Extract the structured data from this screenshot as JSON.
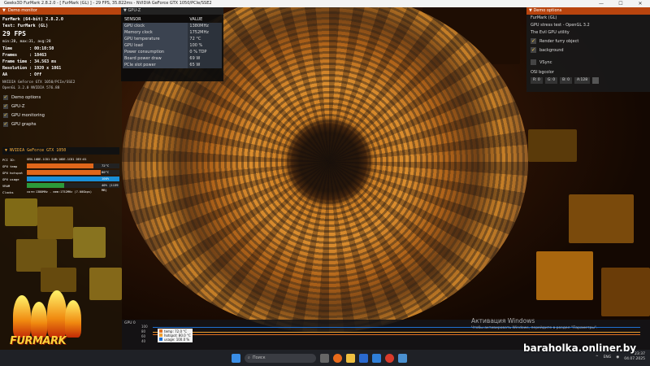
{
  "window": {
    "title": "Geeks3D FurMark 2.8.2.0 - [ FurMark (GL) ] - 29 FPS, 35.822ms - NVIDIA GeForce GTX 1050/PCIe/SSE2",
    "minimize": "—",
    "maximize": "☐",
    "close": "✕"
  },
  "demo_monitor": {
    "header": "Demo monitor",
    "app": "FurMark (64-bit) 2.8.2.0",
    "test": "Test: FurMark (GL)",
    "fps": "29 FPS",
    "minmax": "min:28, max:31, avg:28",
    "time": "Time       : 00:10:50",
    "frames": "Frames     : 18463",
    "frame_time": "Frame time : 34.563 ms",
    "resolution": "Resolution : 1920 x 1061",
    "aa": "AA         : Off",
    "gpu_name": "NVIDIA GeForce GTX 1050/PCIe/SSE2",
    "opengl": "OpenGL 3.2.0 NVIDIA 576.88",
    "checkboxes": [
      "Demo options",
      "GPU-Z",
      "GPU monitoring",
      "GPU graphs"
    ]
  },
  "gpu_monitor": {
    "header": "NVIDIA GeForce GTX 1050",
    "pci": "GEN-10DE-1C81 SUB:10DE-1C81 DEV:01",
    "rows": [
      {
        "label": "GPU temp",
        "value": "72°C",
        "fraction": 0.72,
        "color": "#e0661a"
      },
      {
        "label": "GPU hotspot",
        "value": "80°C",
        "fraction": 0.8,
        "color": "#e0661a"
      },
      {
        "label": "GPU usage",
        "value": "100%",
        "fraction": 1.0,
        "color": "#1a8fd8"
      },
      {
        "label": "VRAM",
        "value": "40% (1139 MB)",
        "fraction": 0.4,
        "color": "#2c9a3a"
      }
    ],
    "clocks_label": "Clocks",
    "clocks_value": "core:1380MHz - mem:1752MHz (7.00Gbps)"
  },
  "gpuz": {
    "header": "GPU-Z",
    "col_sensor": "SENSOR",
    "col_value": "VALUE",
    "rows": [
      [
        "GPU clock",
        "1380MHz"
      ],
      [
        "Memory clock",
        "1752MHz"
      ],
      [
        "GPU temperature",
        "72 °C"
      ],
      [
        "GPU load",
        "100 %"
      ],
      [
        "Power consumption",
        "0 % TDP"
      ],
      [
        "Board power draw",
        "69 W"
      ],
      [
        "PCIe slot power",
        "65 W"
      ]
    ]
  },
  "demo_options": {
    "header": "Demo options",
    "line1": "FurMark (GL)",
    "line2": "GPU stress test - OpenGL 3.2",
    "line3": "The Evil GPU utility",
    "options": [
      {
        "label": "Render furry object",
        "checked": true
      },
      {
        "label": "background",
        "checked": true
      },
      {
        "label": "VSync",
        "checked": false
      }
    ],
    "bg_label": "OSI bgcolor",
    "bg_values": [
      "R: 0",
      "G: 0",
      "B: 0",
      "A:128"
    ]
  },
  "logo": {
    "text": "FURMARK"
  },
  "graph": {
    "label": "GPU 0",
    "ticks": [
      "100",
      "80",
      "60",
      "40"
    ],
    "legend": [
      {
        "text": "temp: 72.0 °C",
        "color": "#e07020"
      },
      {
        "text": "hotspot: 80.0 °C",
        "color": "#f0a030"
      },
      {
        "text": "usage: 100.0 %",
        "color": "#2070d0"
      }
    ]
  },
  "activation": {
    "title": "Активация Windows",
    "subtitle": "Чтобы активировать Windows, перейдите в раздел \"Параметры\"."
  },
  "taskbar": {
    "search_placeholder": "Поиск",
    "lang": "ENG",
    "time": "23:37",
    "date": "04.07.2025"
  },
  "watermark": "baraholka.onliner.by"
}
